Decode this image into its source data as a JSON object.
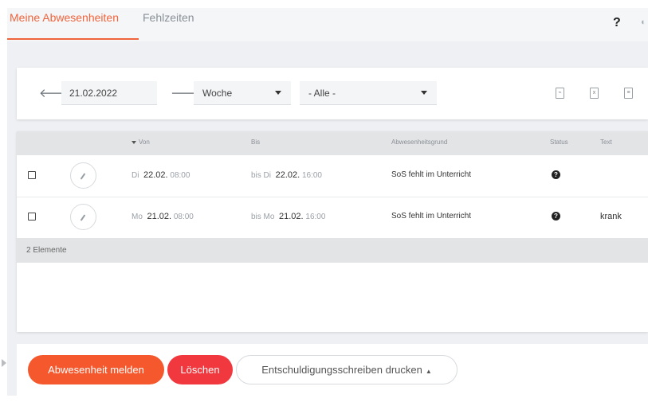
{
  "tabs": [
    {
      "label": "Meine Abwesenheiten",
      "active": true
    },
    {
      "label": "Fehlzeiten",
      "active": false
    }
  ],
  "header": {
    "help_icon": "question-icon",
    "help_label": "?"
  },
  "filter": {
    "prev_icon": "arrow-left-icon",
    "next_icon": "arrow-right-icon",
    "date_value": "21.02.2022",
    "period": "Woche",
    "category": "- Alle -",
    "exports": [
      "pdf-export-icon",
      "excel-export-icon",
      "csv-export-icon"
    ]
  },
  "table": {
    "columns": [
      "Von",
      "Bis",
      "Abwesenheitsgrund",
      "Status",
      "Text"
    ],
    "sort_column": "Von",
    "rows": [
      {
        "von_day": "Di",
        "von_date": "22.02.",
        "von_time": "08:00",
        "bis_prefix": "bis Di",
        "bis_date": "22.02.",
        "bis_time": "16:00",
        "reason": "SoS fehlt im Unterricht",
        "status": "?",
        "text": ""
      },
      {
        "von_day": "Mo",
        "von_date": "21.02.",
        "von_time": "08:00",
        "bis_prefix": "bis Mo",
        "bis_date": "21.02.",
        "bis_time": "16:00",
        "reason": "SoS fehlt im Unterricht",
        "status": "?",
        "text": "krank"
      }
    ],
    "count_label": "2 Elemente"
  },
  "actions": {
    "report": "Abwesenheit melden",
    "delete": "Löschen",
    "print": "Entschuldigungsschreiben drucken",
    "print_caret": "▲"
  },
  "colors": {
    "accent": "#f0643c",
    "report_button": "#f4582c",
    "delete_button": "#f0383e"
  }
}
